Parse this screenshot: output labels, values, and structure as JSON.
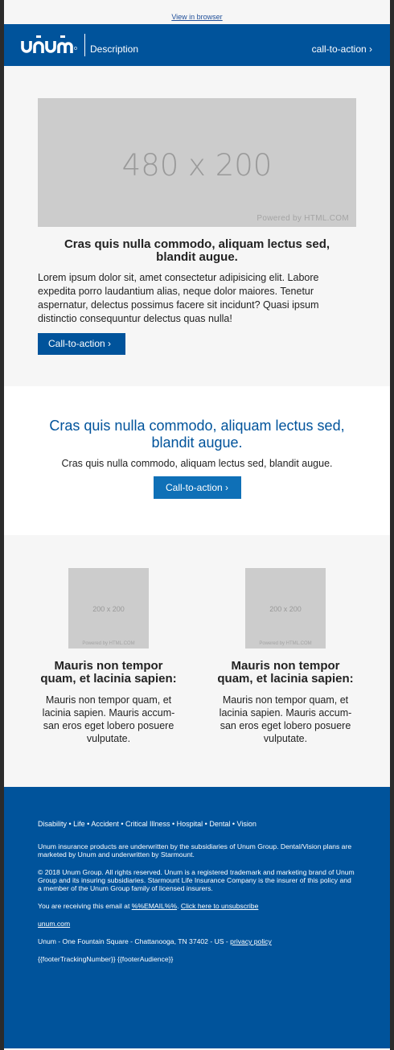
{
  "preheader": {
    "view_in_browser": "View in browser"
  },
  "header": {
    "logo_text": "unum",
    "description": "Description",
    "cta": "call-to-action ›"
  },
  "hero": {
    "image_label": "480 x 200",
    "image_credit": "Powered by HTML.COM",
    "heading": "Cras quis nulla commodo, aliquam lectus sed, blandit augue.",
    "body": "Lorem ipsum dolor sit, amet consectetur adipisicing elit. Labore expedita porro laudantium alias, neque dolor maiores. Tenetur aspernatur, delectus possimus facere sit incidunt? Quasi ipsum distinctio consequuntur delectus quas nulla!",
    "cta": "Call-to-action ›"
  },
  "callout": {
    "heading": "Cras quis nulla commodo, aliquam lectus sed, blandit augue.",
    "body": "Cras quis nulla commodo, aliquam lectus sed, blandit augue.",
    "cta": "Call-to-action ›"
  },
  "columns": [
    {
      "image_label": "200 x 200",
      "image_credit": "Powered by HTML.COM",
      "heading": "Mauris non tempor quam, et lacinia sapien:",
      "body": "Mauris non tempor quam, et lacinia sapien. Mauris accum-san eros eget lobero posuere vulputate."
    },
    {
      "image_label": "200 x 200",
      "image_credit": "Powered by HTML.COM",
      "heading": "Mauris non tempor quam, et lacinia sapien:",
      "body": "Mauris non tempor quam, et lacinia sapien. Mauris accum-san eros eget lobero posuere vulputate."
    }
  ],
  "footer": {
    "product_links": "Disability • Life • Accident • Critical Illness • Hospital • Dental • Vision",
    "underwriting": "Unum insurance products are underwritten by the subsidiaries of Unum Group. Dental/Vision plans are marketed by Unum and underwritten by Starmount.",
    "copyright": "© 2018 Unum Group. All rights reserved. Unum is a registered trademark and marketing brand of Unum Group and its insuring subsidiaries. Starmount Life Insurance Company is the insurer of this policy and a member of the Unum Group family of licensed insurers.",
    "receiving_prefix": "You are receiving this email at ",
    "email_token": "%%EMAIL%%",
    "receiving_sep": ". ",
    "unsubscribe": "Click here to unsubscribe",
    "site_link": "unum.com",
    "address": "Unum - One Fountain Square - Chattanooga, TN 37402 - US - ",
    "privacy": "privacy policy",
    "tracking": "{{footerTrackingNumber}} {{footerAudience}}"
  },
  "colors": {
    "brand_blue": "#00539b",
    "button_blue": "#0f70b7",
    "background": "#f6f6f6"
  }
}
